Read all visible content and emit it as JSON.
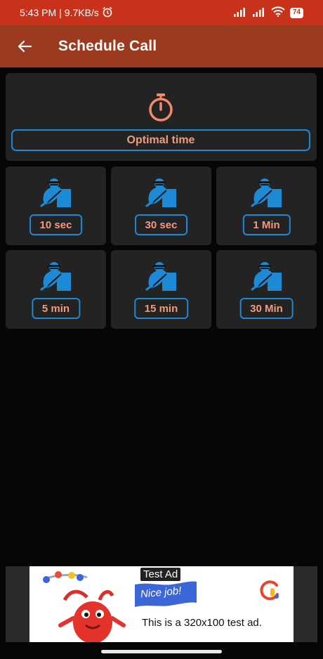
{
  "status_bar": {
    "time": "5:43 PM",
    "separator": "|",
    "net_speed": "9.7KB/s",
    "battery": "74"
  },
  "app_bar": {
    "title": "Schedule Call",
    "back_icon": "arrow-left-icon"
  },
  "optimal": {
    "icon": "stopwatch-icon",
    "label": "Optimal time"
  },
  "timers": [
    {
      "label": "10 sec",
      "icon": "caller-figure-icon"
    },
    {
      "label": "30 sec",
      "icon": "caller-figure-icon"
    },
    {
      "label": "1 Min",
      "icon": "caller-figure-icon"
    },
    {
      "label": "5 min",
      "icon": "caller-figure-icon"
    },
    {
      "label": "15 min",
      "icon": "caller-figure-icon"
    },
    {
      "label": "30 Min",
      "icon": "caller-figure-icon"
    }
  ],
  "ad": {
    "badge": "Test Ad",
    "banner": "Nice job!",
    "text": "This is a 320x100 test ad."
  },
  "colors": {
    "status_bar": "#c8321a",
    "app_bar": "#9c3a1f",
    "card": "#232323",
    "accent_border": "#1e88d6",
    "label_text": "#f29a7e",
    "icon_blue": "#1d8ad6",
    "stopwatch": "#f08a6a"
  }
}
